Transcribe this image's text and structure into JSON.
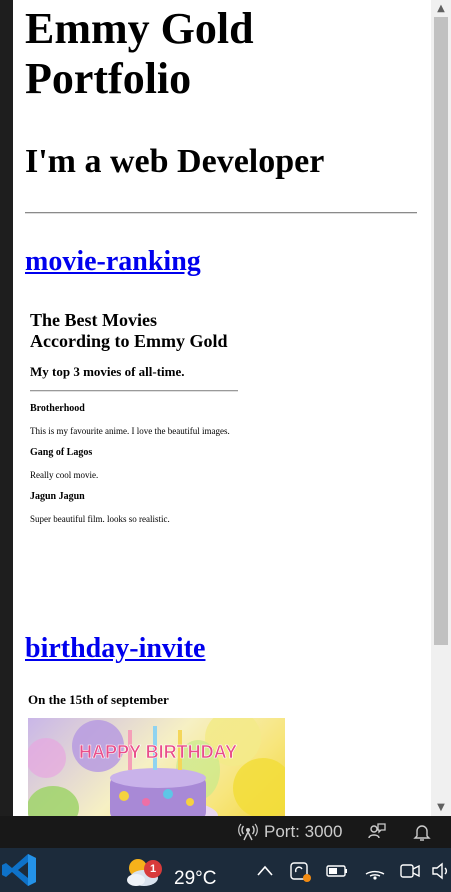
{
  "header": {
    "title_line1": "Emmy Gold",
    "title_line2": "Portfolio",
    "subtitle": "I'm a web Developer"
  },
  "projects": [
    {
      "link": "movie-ranking",
      "preview": {
        "title_line1": "The Best Movies",
        "title_line2": "According to Emmy Gold",
        "subtitle": "My top 3 movies of all-time.",
        "movies": [
          {
            "name": "Brotherhood",
            "description": "This is my favourite anime. I love the beautiful images."
          },
          {
            "name": "Gang of Lagos",
            "description": "Really cool movie."
          },
          {
            "name": "Jagun Jagun",
            "description": "Super beautiful film. looks so realistic."
          }
        ]
      }
    },
    {
      "link": "birthday-invite",
      "preview": {
        "date_text": "On the 15th of september",
        "image_text": "HAPPY BIRTHDAY"
      }
    }
  ],
  "statusbar": {
    "port_label": "Port: 3000",
    "icons": [
      "broadcast-icon",
      "feedback-icon",
      "bell-icon"
    ]
  },
  "taskbar": {
    "weather_badge": "1",
    "temperature": "29°C",
    "icons": [
      "vscode-icon",
      "weather-icon",
      "chevron-up-icon",
      "onedrive-icon",
      "battery-icon",
      "wifi-icon",
      "camera-icon",
      "volume-icon"
    ]
  },
  "colors": {
    "link": "#0000ee",
    "statusbar_bg": "#181818",
    "taskbar_bg": "#1c2b3b",
    "vscode_blue": "#0e72c9",
    "badge_red": "#d83b3b"
  }
}
